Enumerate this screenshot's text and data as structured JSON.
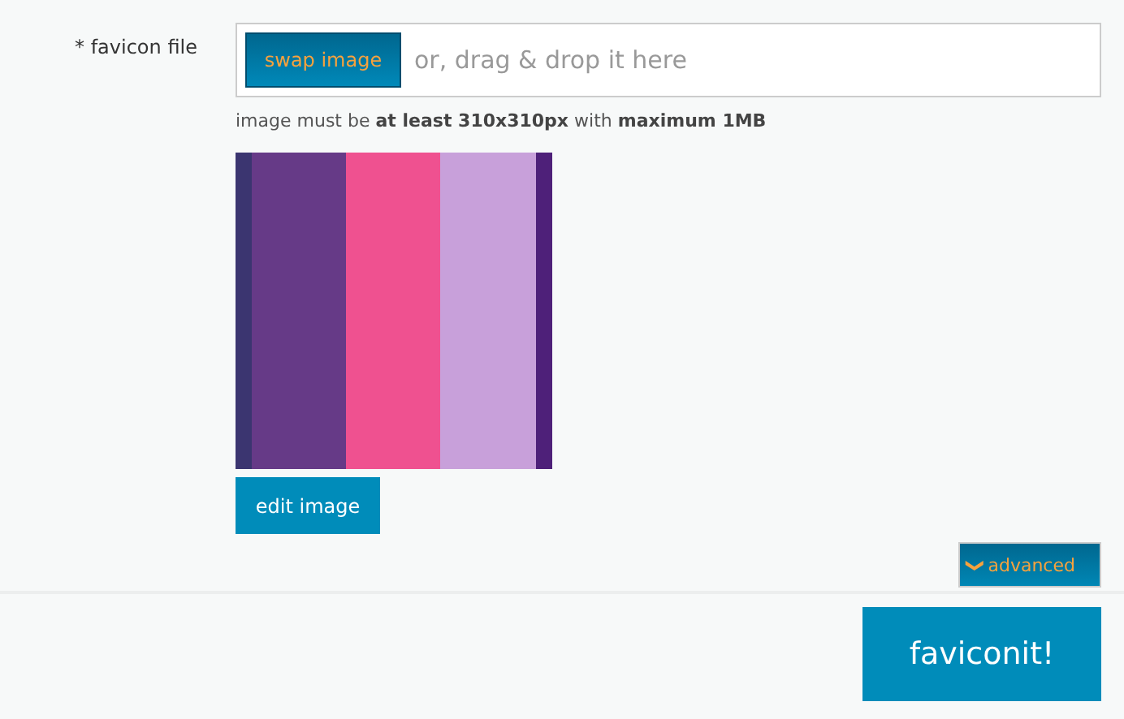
{
  "field": {
    "label": "* favicon file",
    "button": "swap image",
    "placeholder": "or, drag & drop it here",
    "hint": "image must be **at least 310x310px** with **maximum 1MB**"
  },
  "edit_button": "edit image",
  "advanced_button": {
    "icon": "❯",
    "label": "advanced",
    "expanded": false
  },
  "submit_button": "faviconit!"
}
